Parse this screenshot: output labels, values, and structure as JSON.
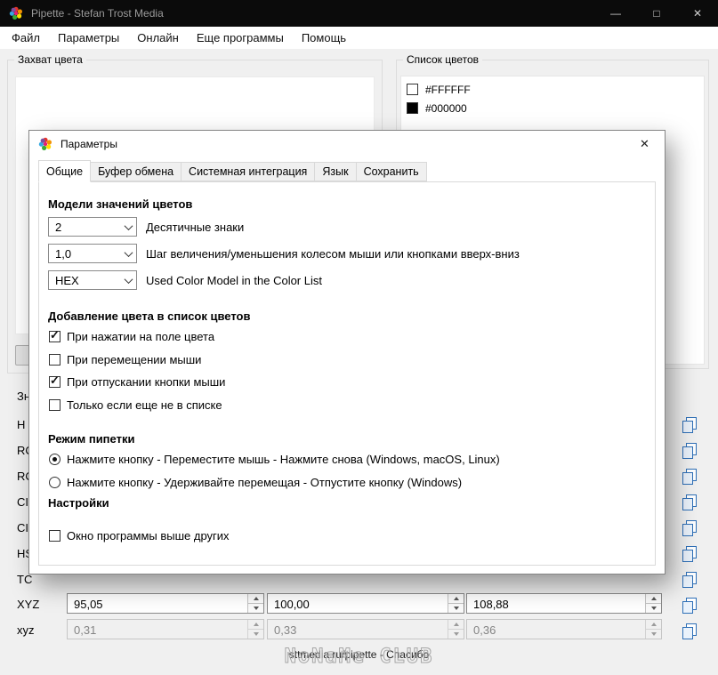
{
  "window": {
    "title": "Pipette - Stefan Trost Media",
    "controls": {
      "minimize": "—",
      "maximize": "□",
      "close": "✕"
    }
  },
  "menu": {
    "items": [
      "Файл",
      "Параметры",
      "Онлайн",
      "Еще программы",
      "Помощь"
    ]
  },
  "groups": {
    "capture": "Захват цвета",
    "color_list": "Список цветов",
    "values_partial": "Зн"
  },
  "color_list": {
    "items": [
      {
        "swatch": "#FFFFFF",
        "label": "#FFFFFF"
      },
      {
        "swatch": "#000000",
        "label": "#000000"
      }
    ]
  },
  "left_panel": {
    "row_labels_partial": [
      "H",
      "RC",
      "RC",
      "CI",
      "CI",
      "HS",
      "TC"
    ],
    "rows": [
      {
        "label": "XYZ",
        "values": [
          "95,05",
          "100,00",
          "108,88"
        ]
      },
      {
        "label": "xyz",
        "values": [
          "0,31",
          "0,33",
          "0,36"
        ]
      }
    ]
  },
  "dialog": {
    "title": "Параметры",
    "close": "✕",
    "tabs": [
      "Общие",
      "Буфер обмена",
      "Системная интеграция",
      "Язык",
      "Сохранить"
    ],
    "headings": {
      "models": "Модели значений цветов",
      "adding": "Добавление цвета в список цветов",
      "mode": "Режим пипетки",
      "settings": "Настройки"
    },
    "combos": [
      {
        "value": "2",
        "label": "Десятичные знаки"
      },
      {
        "value": "1,0",
        "label": "Шаг величения/уменьшения колесом мыши или кнопками вверх-вниз"
      },
      {
        "value": "HEX",
        "label": "Used Color Model in the Color List"
      }
    ],
    "add_checkboxes": [
      {
        "label": "При нажатии на поле цвета",
        "checked": true
      },
      {
        "label": "При перемещении мыши",
        "checked": false
      },
      {
        "label": "При отпускании кнопки мыши",
        "checked": true
      },
      {
        "label": "Только если еще не в списке",
        "checked": false
      }
    ],
    "mode_radios": [
      {
        "label": "Нажмите кнопку - Переместите мышь - Нажмите снова (Windows, macOS, Linux)",
        "selected": true
      },
      {
        "label": "Нажмите кнопку - Удерживайте перемещая - Отпустите кнопку (Windows)",
        "selected": false
      }
    ],
    "settings_checkboxes": [
      {
        "label": "Окно программы выше других",
        "checked": false
      }
    ]
  },
  "statusbar": {
    "text": "sttmedia.ru/pipette - Спасибо",
    "watermark": "NoNaMe CLUB"
  },
  "icons": {
    "check": "✓"
  },
  "colors": {
    "titlebar_bg": "#0b0b0b",
    "client_bg": "#f0f0f0",
    "copy_icon_accent": "#2e6fb7"
  }
}
